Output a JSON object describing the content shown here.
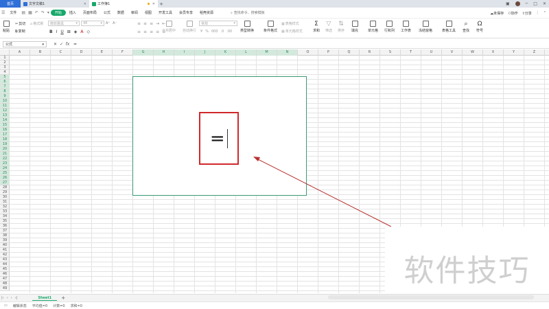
{
  "tabs": [
    {
      "label": "首页",
      "icon": "home-icon"
    },
    {
      "label": "文字文稿1",
      "icon": "word-doc-icon",
      "color": "#2f6fd8"
    },
    {
      "label": "工作簿1",
      "icon": "spreadsheet-icon",
      "color": "#17a86a"
    }
  ],
  "menu": {
    "file": "文件",
    "items": [
      "开始",
      "插入",
      "页面布局",
      "公式",
      "数据",
      "审阅",
      "视图",
      "开发工具",
      "会员专享",
      "稻壳资源"
    ],
    "active": "开始",
    "search_placeholder": "查找命令、搜索模板",
    "unsaved": "未保存",
    "collab": "协作",
    "share": "分享"
  },
  "ribbon": {
    "paste": "粘贴",
    "cut": "剪切",
    "copy": "复制",
    "format_painter": "格式刷",
    "font_name": "微软雅黑",
    "font_size": "48",
    "merge_center": "合并居中",
    "auto_wrap": "自动换行",
    "num_format": "常规",
    "type_convert": "类型转换",
    "cond_format": "条件格式",
    "table_style": "表格样式",
    "cell_style": "单元格样式",
    "sum": "求和",
    "filter": "筛选",
    "sort": "排序",
    "fill": "填充",
    "cell": "单元格",
    "row_col": "行和列",
    "worksheet": "工作表",
    "freeze": "冻结窗格",
    "table_tools": "表格工具",
    "find": "查找",
    "symbol": "符号"
  },
  "formula_bar": {
    "name_box": "公式",
    "fx": "fx",
    "content": "="
  },
  "columns": [
    "A",
    "B",
    "C",
    "D",
    "E",
    "F",
    "G",
    "H",
    "I",
    "J",
    "K",
    "L",
    "M",
    "N",
    "O",
    "P",
    "Q",
    "R",
    "S",
    "T",
    "U",
    "V",
    "W",
    "X",
    "Y",
    "Z"
  ],
  "highlighted_columns": [
    "G",
    "H",
    "I",
    "J",
    "K",
    "L",
    "M",
    "N"
  ],
  "rows": [
    "1",
    "2",
    "3",
    "4",
    "5",
    "6",
    "7",
    "8",
    "9",
    "10",
    "11",
    "12",
    "13",
    "14",
    "15",
    "16",
    "17",
    "18",
    "19",
    "20",
    "21",
    "22",
    "23",
    "24",
    "25",
    "26",
    "27",
    "28",
    "29",
    "30",
    "31",
    "32",
    "33",
    "34",
    "35",
    "36",
    "37",
    "38",
    "39",
    "40",
    "41",
    "42",
    "43",
    "44",
    "45",
    "46",
    "47",
    "48",
    "49"
  ],
  "highlighted_rows": [
    "5",
    "6",
    "7",
    "8",
    "9",
    "10",
    "11",
    "12",
    "13",
    "14",
    "15",
    "16",
    "17",
    "18",
    "19",
    "20",
    "21",
    "22",
    "23",
    "24",
    "25",
    "26",
    "27"
  ],
  "cell_edit": {
    "content": "="
  },
  "watermark": "软件技巧",
  "sheet": {
    "name": "Sheet1"
  },
  "status": {
    "mode": "编辑状态",
    "average": "平均值=0",
    "count": "计数=0",
    "sum": "求和=0"
  },
  "colors": {
    "accent": "#17a86a",
    "highlight": "#d3e9dd",
    "annotation": "#d0282a",
    "arrow": "#b83030"
  }
}
